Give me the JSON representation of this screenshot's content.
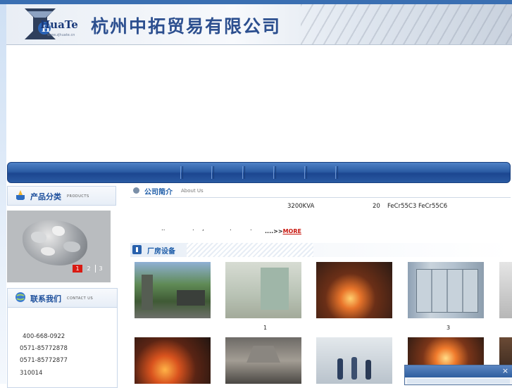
{
  "header": {
    "logo_text": "HuaTe",
    "logo_url_text": "www.zjhuate.cn",
    "company_name": "杭州中拓贸易有限公司"
  },
  "nav": {
    "items": [
      "",
      "",
      "",
      "",
      ""
    ]
  },
  "sidebar": {
    "products": {
      "title_cn": "产品分类",
      "title_en": "PRODUCTS",
      "pages": [
        "1",
        "2",
        "3"
      ],
      "active_page": "1"
    },
    "contact": {
      "title_cn": "联系我们",
      "title_en": "CONTACT US",
      "lines": [
        "400-668-0922",
        "0571-85772878",
        "0571-85772877",
        "310014"
      ]
    }
  },
  "about": {
    "title_cn": "公司简介",
    "title_en": "About Us",
    "text_a": "3200KVA",
    "text_b": "20",
    "text_c": "FeCr55C3 FeCr55C6",
    "dots": [
      "..",
      ".",
      ",",
      ".",
      "."
    ],
    "more_prefix": "....>>",
    "more_label": "MORE"
  },
  "facilities": {
    "title_cn": "厂房设备",
    "captions": [
      "",
      "1",
      "",
      "3"
    ]
  },
  "colors": {
    "brand_blue": "#2c5da4",
    "accent_red": "#d91a12",
    "heading_blue": "#1d4f9c"
  },
  "popup": {
    "close_label": "×"
  }
}
